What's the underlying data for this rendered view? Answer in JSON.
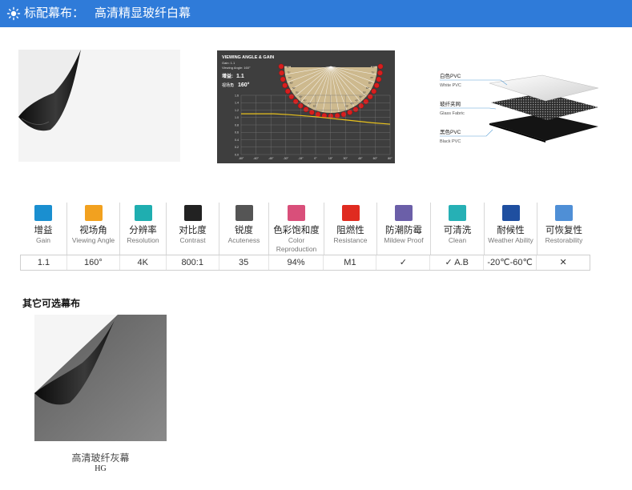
{
  "header": {
    "label": "标配幕布：",
    "title": "高清精显玻纤白幕",
    "icon": "sun-icon",
    "bg_color": "#2f7bd9"
  },
  "gain_chart": {
    "title": "VIEWING ANGLE & GAIN",
    "gain_line": "Gain: 1.1",
    "angle_line": "Viewing Angle: 160°",
    "gain_cn": "增益:",
    "gain_cn_value": "1.1",
    "angle_cn": "视场角",
    "angle_cn_value": "160°",
    "left_degree_labels": [
      "80°",
      "75°",
      "70°",
      "65°",
      "60°",
      "55°",
      "50°",
      "45°",
      "40°",
      "35°"
    ],
    "right_degree_labels": [
      "80°",
      "75°",
      "70°",
      "65°",
      "60°",
      "55°",
      "50°",
      "45°",
      "40°",
      "35°"
    ],
    "bottom_arc_labels": [
      "30°",
      "25°",
      "20°",
      "15°",
      "10°",
      "5°",
      "0°",
      "5°",
      "10°",
      "15°",
      "20°",
      "25°",
      "30°"
    ],
    "x_tick_labels": [
      "-80°",
      "-60°",
      "-45°",
      "-30°",
      "-15°",
      "0°",
      "15°",
      "30°",
      "45°",
      "60°",
      "80°"
    ],
    "y_tick_labels": [
      "1.6",
      "1.4",
      "1.2",
      "1.0",
      "0.8",
      "0.6",
      "0.4",
      "0.2",
      "0.0"
    ],
    "chart_data": {
      "type": "line",
      "x": [
        -80,
        -60,
        -45,
        -30,
        -15,
        0,
        15,
        30,
        45,
        60,
        80
      ],
      "values": [
        1.1,
        1.1,
        1.1,
        1.08,
        1.05,
        1.02,
        0.98,
        0.94,
        0.9,
        0.86,
        0.82
      ],
      "ylim": [
        0,
        1.6
      ],
      "grid": true
    }
  },
  "layers": {
    "items": [
      {
        "cn": "白色PVC",
        "en": "White PVC"
      },
      {
        "cn": "玻纤夹网",
        "en": "Glass Fabric"
      },
      {
        "cn": "黑色PVC",
        "en": "Black PVC"
      }
    ]
  },
  "specs": {
    "columns": [
      {
        "icon": "gain-icon",
        "color": "#1a8fd0",
        "name": "增益",
        "sub": "Gain",
        "value": "1.1"
      },
      {
        "icon": "viewing-angle-icon",
        "color": "#f2a11f",
        "name": "视场角",
        "sub": "Viewing Angle",
        "value": "160°"
      },
      {
        "icon": "resolution-icon",
        "color": "#1faeb0",
        "name": "分辨率",
        "sub": "Resolution",
        "value": "4K"
      },
      {
        "icon": "contrast-icon",
        "color": "#222222",
        "name": "对比度",
        "sub": "Contrast",
        "value": "800:1"
      },
      {
        "icon": "acuteness-icon",
        "color": "#555555",
        "name": "锐度",
        "sub": "Acuteness",
        "value": "35"
      },
      {
        "icon": "color-reproduction-icon",
        "color": "#d94f7a",
        "name": "色彩饱和度",
        "sub": "Color Reproduction",
        "value": "94%"
      },
      {
        "icon": "flame-icon",
        "color": "#e02b20",
        "name": "阻燃性",
        "sub": "Resistance",
        "value": "M1"
      },
      {
        "icon": "mildew-proof-icon",
        "color": "#6b5fa8",
        "name": "防潮防霉",
        "sub": "Mildew Proof",
        "value": "✓"
      },
      {
        "icon": "clean-icon",
        "color": "#26b0b5",
        "name": "可清洗",
        "sub": "Clean",
        "value": "✓ A.B"
      },
      {
        "icon": "thermometer-icon",
        "color": "#1f4fa0",
        "name": "耐候性",
        "sub": "Weather Ability",
        "value": "-20℃-60℃"
      },
      {
        "icon": "restorability-icon",
        "color": "#4f8fd6",
        "name": "可恢复性",
        "sub": "Restorability",
        "value": "✕"
      }
    ]
  },
  "other": {
    "title": "其它可选幕布",
    "item_caption": "高清玻纤灰幕",
    "item_code": "HG"
  }
}
